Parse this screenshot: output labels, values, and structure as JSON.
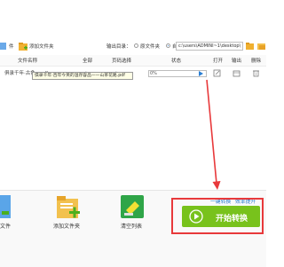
{
  "toolbar": {
    "add_file_partial": "件",
    "add_folder": "添加文件夹",
    "output_dir_label": "输出目录：",
    "option_original": "原文件夹",
    "option_custom": "自定义",
    "path": "c:\\users\\ADMINI~1\\desktop\\"
  },
  "table": {
    "headers": [
      "文件名称",
      "全部",
      "页码选择",
      "状态",
      "打开",
      "输出",
      "删除"
    ],
    "rows": [
      {
        "name": "俱录千年·古色 ·p.df",
        "status": "0%"
      }
    ],
    "tooltip": "俱录千年·百年今英的温存容品——山茶花路.pdf"
  },
  "bottom": {
    "add_file_partial": "文件",
    "add_folder": "添加文件夹",
    "clear_list": "清空列表",
    "link_one_click": "一键转换",
    "link_efficiency": "效率提升",
    "start_button": "开始转换"
  },
  "colors": {
    "accent_blue": "#2a7fd4",
    "start_green": "#78c21c",
    "highlight_red": "#e8393b"
  }
}
